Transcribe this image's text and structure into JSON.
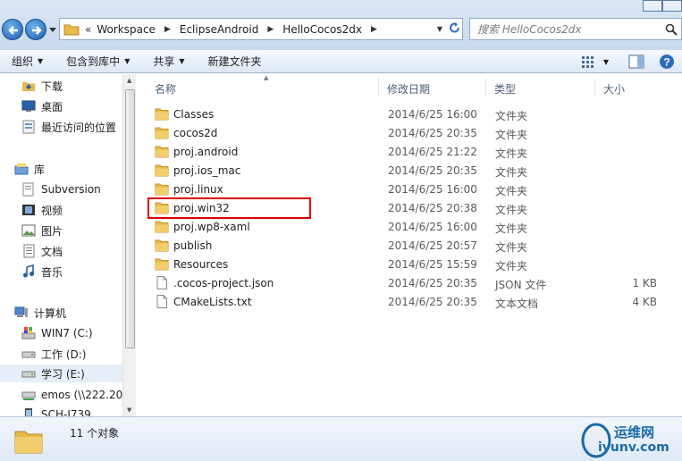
{
  "address_bar": {
    "overflow": "«",
    "crumbs": [
      "Workspace",
      "EclipseAndroid",
      "HelloCocos2dx"
    ],
    "search_placeholder": "搜索 HelloCocos2dx"
  },
  "toolbar": {
    "organize": "组织",
    "include_in_library": "包含到库中",
    "share": "共享",
    "new_folder": "新建文件夹"
  },
  "nav": {
    "items": [
      {
        "label": "下载",
        "icon": "download-folder-icon"
      },
      {
        "label": "桌面",
        "icon": "desktop-icon"
      },
      {
        "label": "最近访问的位置",
        "icon": "recent-places-icon"
      },
      {
        "label": "库",
        "icon": "library-icon"
      },
      {
        "label": "Subversion",
        "icon": "subversion-library-icon"
      },
      {
        "label": "视频",
        "icon": "video-library-icon"
      },
      {
        "label": "图片",
        "icon": "pictures-library-icon"
      },
      {
        "label": "文档",
        "icon": "documents-library-icon"
      },
      {
        "label": "音乐",
        "icon": "music-library-icon"
      },
      {
        "label": "计算机",
        "icon": "computer-icon"
      },
      {
        "label": "WIN7 (C:)",
        "icon": "system-drive-icon"
      },
      {
        "label": "工作 (D:)",
        "icon": "drive-icon"
      },
      {
        "label": "学习 (E:)",
        "icon": "drive-icon"
      },
      {
        "label": "emos (\\\\222.20",
        "icon": "network-drive-icon"
      },
      {
        "label": "SCH-I739",
        "icon": "device-icon"
      }
    ]
  },
  "columns": {
    "name": "名称",
    "date": "修改日期",
    "type": "类型",
    "size": "大小"
  },
  "files": [
    {
      "name": "Classes",
      "date": "2014/6/25 16:00",
      "type": "文件夹",
      "size": "",
      "kind": "folder"
    },
    {
      "name": "cocos2d",
      "date": "2014/6/25 20:35",
      "type": "文件夹",
      "size": "",
      "kind": "folder"
    },
    {
      "name": "proj.android",
      "date": "2014/6/25 21:22",
      "type": "文件夹",
      "size": "",
      "kind": "folder"
    },
    {
      "name": "proj.ios_mac",
      "date": "2014/6/25 20:35",
      "type": "文件夹",
      "size": "",
      "kind": "folder"
    },
    {
      "name": "proj.linux",
      "date": "2014/6/25 16:00",
      "type": "文件夹",
      "size": "",
      "kind": "folder"
    },
    {
      "name": "proj.win32",
      "date": "2014/6/25 20:38",
      "type": "文件夹",
      "size": "",
      "kind": "folder"
    },
    {
      "name": "proj.wp8-xaml",
      "date": "2014/6/25 16:00",
      "type": "文件夹",
      "size": "",
      "kind": "folder"
    },
    {
      "name": "publish",
      "date": "2014/6/25 20:57",
      "type": "文件夹",
      "size": "",
      "kind": "folder"
    },
    {
      "name": "Resources",
      "date": "2014/6/25 15:59",
      "type": "文件夹",
      "size": "",
      "kind": "folder"
    },
    {
      "name": ".cocos-project.json",
      "date": "2014/6/25 20:35",
      "type": "JSON 文件",
      "size": "1 KB",
      "kind": "file"
    },
    {
      "name": "CMakeLists.txt",
      "date": "2014/6/25 20:35",
      "type": "文本文档",
      "size": "4 KB",
      "kind": "file"
    }
  ],
  "status": {
    "count": "11 个对象"
  },
  "watermark": {
    "line1": "运维网",
    "line2": "iyunv.com"
  },
  "colors": {
    "highlight": "#e30000",
    "folder": "#e8b84a",
    "accent": "#1a5fb0"
  }
}
